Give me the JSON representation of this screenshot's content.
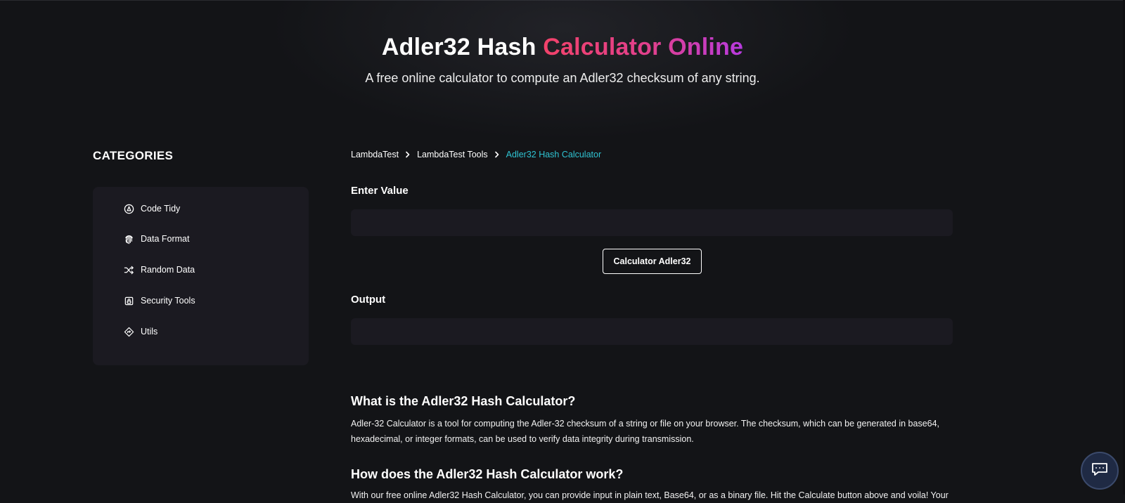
{
  "hero": {
    "title_part1": "Adler32 Hash",
    "title_part2": "Calculator Online",
    "subtitle": "A free online calculator to compute an Adler32 checksum of any string."
  },
  "sidebar": {
    "title": "CATEGORIES",
    "items": [
      {
        "label": "Code Tidy",
        "icon": "code-tidy-icon"
      },
      {
        "label": "Data Format",
        "icon": "fingerprint-icon"
      },
      {
        "label": "Random Data",
        "icon": "shuffle-icon"
      },
      {
        "label": "Security Tools",
        "icon": "lock-icon"
      },
      {
        "label": "Utils",
        "icon": "utils-icon"
      }
    ]
  },
  "breadcrumb": {
    "items": [
      "LambdaTest",
      "LambdaTest Tools"
    ],
    "current": "Adler32 Hash Calculator"
  },
  "form": {
    "input_label": "Enter Value",
    "input_value": "",
    "button_label": "Calculator Adler32",
    "output_label": "Output",
    "output_value": ""
  },
  "content": {
    "section1_heading": "What is the Adler32 Hash Calculator?",
    "section1_text": "Adler-32 Calculator is a tool for computing the Adler-32 checksum of a string or file on your browser. The checksum, which can be generated in base64, hexadecimal, or integer formats, can be used to verify data integrity during transmission.",
    "section2_heading": "How does the Adler32 Hash Calculator work?",
    "section2_text": "With our free online Adler32 Hash Calculator, you can provide input in plain text, Base64, or as a binary file. Hit the Calculate button above and voila! Your"
  },
  "chat": {
    "icon": "chat-icon"
  },
  "colors": {
    "background": "#131417",
    "panel": "#1b1a21",
    "accent_start": "#f2426a",
    "accent_end": "#b73adf",
    "breadcrumb_current": "#2fc3d2"
  }
}
